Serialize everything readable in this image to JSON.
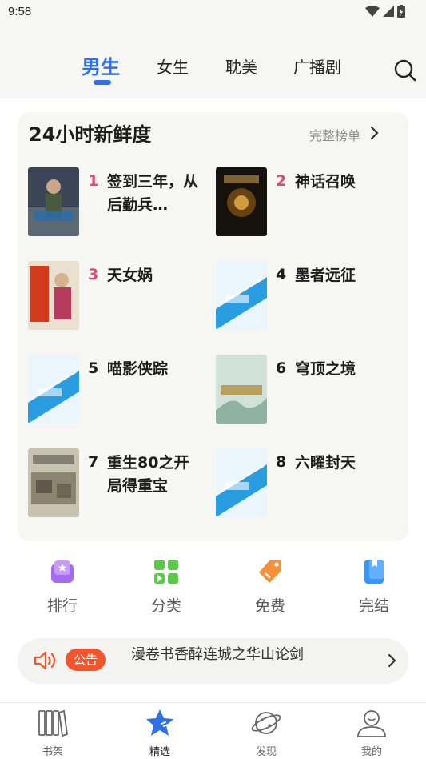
{
  "status_bar": {
    "time": "9:58"
  },
  "top_tabs": [
    {
      "label": "男生",
      "active": true
    },
    {
      "label": "女生",
      "active": false
    },
    {
      "label": "耽美",
      "active": false
    },
    {
      "label": "广播剧",
      "active": false
    }
  ],
  "ranking": {
    "title": "24小时新鲜度",
    "more_label": "完整榜单",
    "books": [
      {
        "rank": "1",
        "title": "签到三年，从后勤兵…"
      },
      {
        "rank": "2",
        "title": "神话召唤"
      },
      {
        "rank": "3",
        "title": "天女娲"
      },
      {
        "rank": "4",
        "title": "墨者远征"
      },
      {
        "rank": "5",
        "title": "喵影侠踪"
      },
      {
        "rank": "6",
        "title": "穹顶之境"
      },
      {
        "rank": "7",
        "title": "重生80之开局得重宝"
      },
      {
        "rank": "8",
        "title": "六曜封天"
      }
    ]
  },
  "quick_nav": [
    {
      "label": "排行",
      "icon": "ranking-icon"
    },
    {
      "label": "分类",
      "icon": "category-icon"
    },
    {
      "label": "免费",
      "icon": "free-tag-icon"
    },
    {
      "label": "完结",
      "icon": "finished-book-icon"
    }
  ],
  "notice": {
    "tag": "公告",
    "text": "漫卷书香醉连城之华山论剑"
  },
  "bottom_nav": [
    {
      "label": "书架",
      "icon": "bookshelf-icon",
      "active": false
    },
    {
      "label": "精选",
      "icon": "star-icon",
      "active": true
    },
    {
      "label": "发现",
      "icon": "planet-icon",
      "active": false
    },
    {
      "label": "我的",
      "icon": "profile-icon",
      "active": false
    }
  ],
  "colors": {
    "accent": "#2f6fe8",
    "hot_rank": "#e24b71",
    "notice_tag": "#f2552c"
  }
}
